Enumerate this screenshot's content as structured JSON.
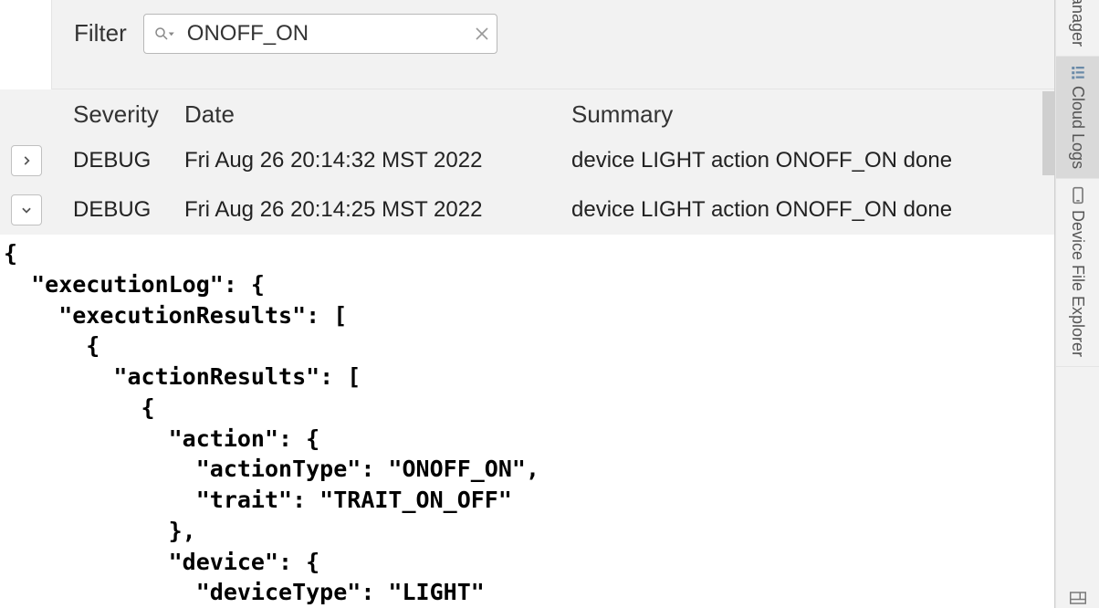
{
  "toolbar": {
    "filter_label": "Filter",
    "search_value": "ONOFF_ON",
    "search_placeholder": ""
  },
  "columns": {
    "severity": "Severity",
    "date": "Date",
    "summary": "Summary"
  },
  "rows": [
    {
      "expanded": false,
      "severity": "DEBUG",
      "date": "Fri Aug 26 20:14:32 MST 2022",
      "summary": "device LIGHT action ONOFF_ON done"
    },
    {
      "expanded": true,
      "severity": "DEBUG",
      "date": "Fri Aug 26 20:14:25 MST 2022",
      "summary": "device LIGHT action ONOFF_ON done"
    }
  ],
  "detail_json": "{\n  \"executionLog\": {\n    \"executionResults\": [\n      {\n        \"actionResults\": [\n          {\n            \"action\": {\n              \"actionType\": \"ONOFF_ON\",\n              \"trait\": \"TRAIT_ON_OFF\"\n            },\n            \"device\": {\n              \"deviceType\": \"LIGHT\"",
  "sidebar": {
    "tabs": [
      {
        "id": "manager",
        "label": "Manager",
        "icon": "none",
        "partial_top": true
      },
      {
        "id": "cloud-logs",
        "label": "Cloud Logs",
        "icon": "logs",
        "active": true
      },
      {
        "id": "device-file-explorer",
        "label": "Device File Explorer",
        "icon": "device"
      },
      {
        "id": "extra",
        "label": "",
        "icon": "layout",
        "partial_bottom": true
      }
    ]
  }
}
